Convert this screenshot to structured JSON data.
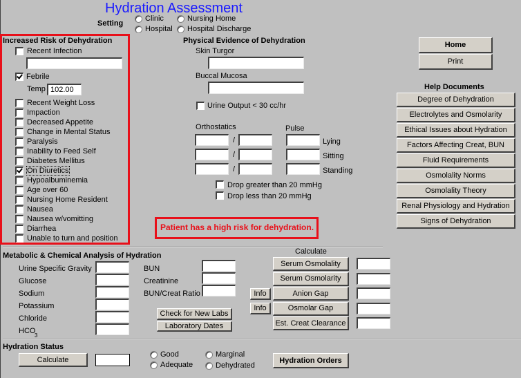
{
  "header": {
    "title": "Hydration Assessment",
    "setting_label": "Setting",
    "setting_options": [
      {
        "label": "Clinic",
        "selected": false
      },
      {
        "label": "Nursing Home",
        "selected": false
      },
      {
        "label": "Hospital",
        "selected": false
      },
      {
        "label": "Hospital Discharge",
        "selected": false
      }
    ]
  },
  "risk": {
    "title": "Increased Risk of Dehydration",
    "recent_infection": {
      "label": "Recent Infection",
      "checked": false,
      "value": ""
    },
    "febrile": {
      "label": "Febrile",
      "checked": true
    },
    "temp": {
      "label": "Temp",
      "value": "102.00"
    },
    "items": [
      {
        "label": "Recent Weight Loss",
        "checked": false
      },
      {
        "label": "Impaction",
        "checked": false
      },
      {
        "label": "Decreased Appetite",
        "checked": false
      },
      {
        "label": "Change in Mental Status",
        "checked": false
      },
      {
        "label": "Paralysis",
        "checked": false
      },
      {
        "label": "Inability to Feed Self",
        "checked": false
      },
      {
        "label": "Diabetes Mellitus",
        "checked": false
      },
      {
        "label": "On Diuretics",
        "checked": true
      },
      {
        "label": "Hypoalbuminemia",
        "checked": false
      },
      {
        "label": "Age over 60",
        "checked": false
      },
      {
        "label": "Nursing Home Resident",
        "checked": false
      },
      {
        "label": "Nausea",
        "checked": false
      },
      {
        "label": "Nausea w/vomitting",
        "checked": false
      },
      {
        "label": "Diarrhea",
        "checked": false
      },
      {
        "label": "Unable to turn and position",
        "checked": false
      }
    ]
  },
  "physical": {
    "title": "Physical Evidence of Dehydration",
    "skin_turgor_label": "Skin Turgor",
    "skin_turgor_value": "",
    "buccal_label": "Buccal Mucosa",
    "buccal_value": "",
    "urine_label": "Urine Output < 30 cc/hr",
    "orthostatics_label": "Orthostatics",
    "pulse_label": "Pulse",
    "slash": "/",
    "positions": [
      "Lying",
      "Sitting",
      "Standing"
    ],
    "drop_greater": "Drop greater than 20 mmHg",
    "drop_less": "Drop less than 20 mmHg"
  },
  "alert": {
    "message": "Patient has a high risk for dehydration.",
    "color": "#e8101a"
  },
  "nav": {
    "home": "Home",
    "print": "Print"
  },
  "help": {
    "title": "Help Documents",
    "items": [
      "Degree of Dehydration",
      "Electrolytes and Osmolarity",
      "Ethical Issues about Hydration",
      "Factors Affecting Creat, BUN",
      "Fluid Requirements",
      "Osmolality Norms",
      "Osmolality Theory",
      "Renal Physiology and Hydration",
      "Signs of Dehydration"
    ]
  },
  "labs": {
    "title": "Metabolic & Chemical Analysis of Hydration",
    "left": [
      "Urine Specific Gravity",
      "Glucose",
      "Sodium",
      "Potassium",
      "Chloride",
      "HCO"
    ],
    "hco_sub": "3",
    "right": [
      "BUN",
      "Creatinine",
      "BUN/Creat Ratio"
    ],
    "check_labs": "Check for New Labs",
    "lab_dates": "Laboratory Dates",
    "calculate_label": "Calculate",
    "info": "Info",
    "calc_buttons": [
      "Serum Osmolality",
      "Serum Osmolarity",
      "Anion Gap",
      "Osmolar Gap",
      "Est. Creat Clearance"
    ]
  },
  "status": {
    "title": "Hydration Status",
    "calculate": "Calculate",
    "value": "",
    "options": [
      "Good",
      "Marginal",
      "Adequate",
      "Dehydrated"
    ],
    "orders": "Hydration Orders"
  },
  "colors": {
    "background": "#c0c0c0",
    "title": "#1a1aff",
    "alert": "#e8101a"
  }
}
